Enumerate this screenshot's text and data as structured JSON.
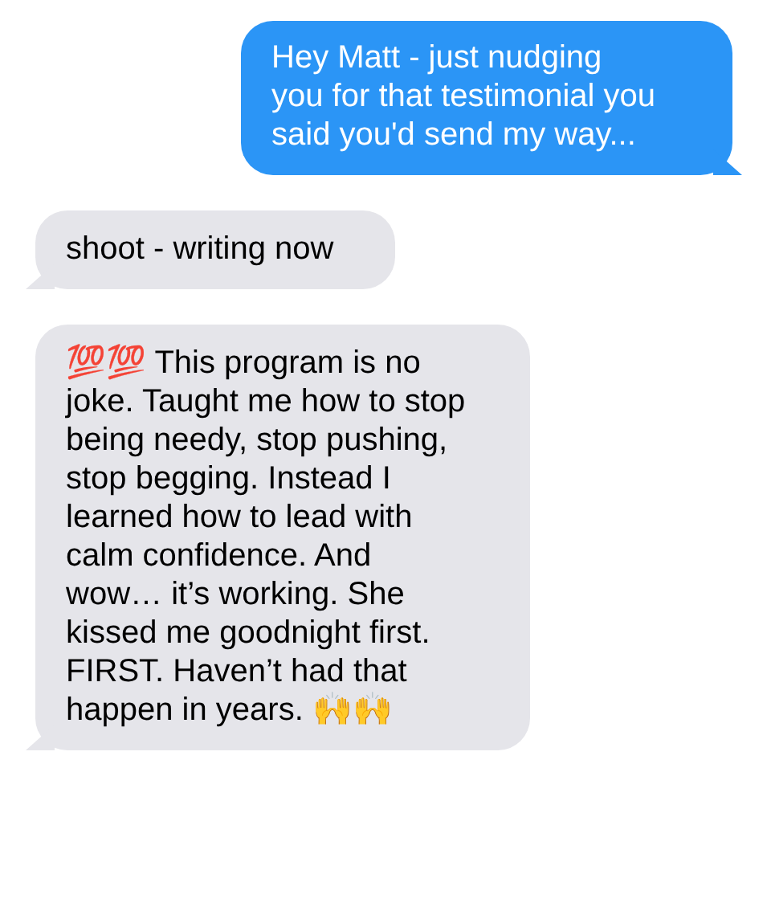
{
  "messages": [
    {
      "kind": "sent",
      "text": "Hey Matt - just nudging you for that testimonial you said you'd send my way..."
    },
    {
      "kind": "received",
      "text": "shoot - writing now"
    },
    {
      "kind": "received",
      "text": "💯💯 This program is no joke. Taught me how to stop being needy, stop pushing, stop begging. Instead I learned how to lead with calm confidence. And wow… it’s working. She kissed me goodnight first. FIRST. Haven’t had that happen in years. 🙌🙌"
    }
  ]
}
